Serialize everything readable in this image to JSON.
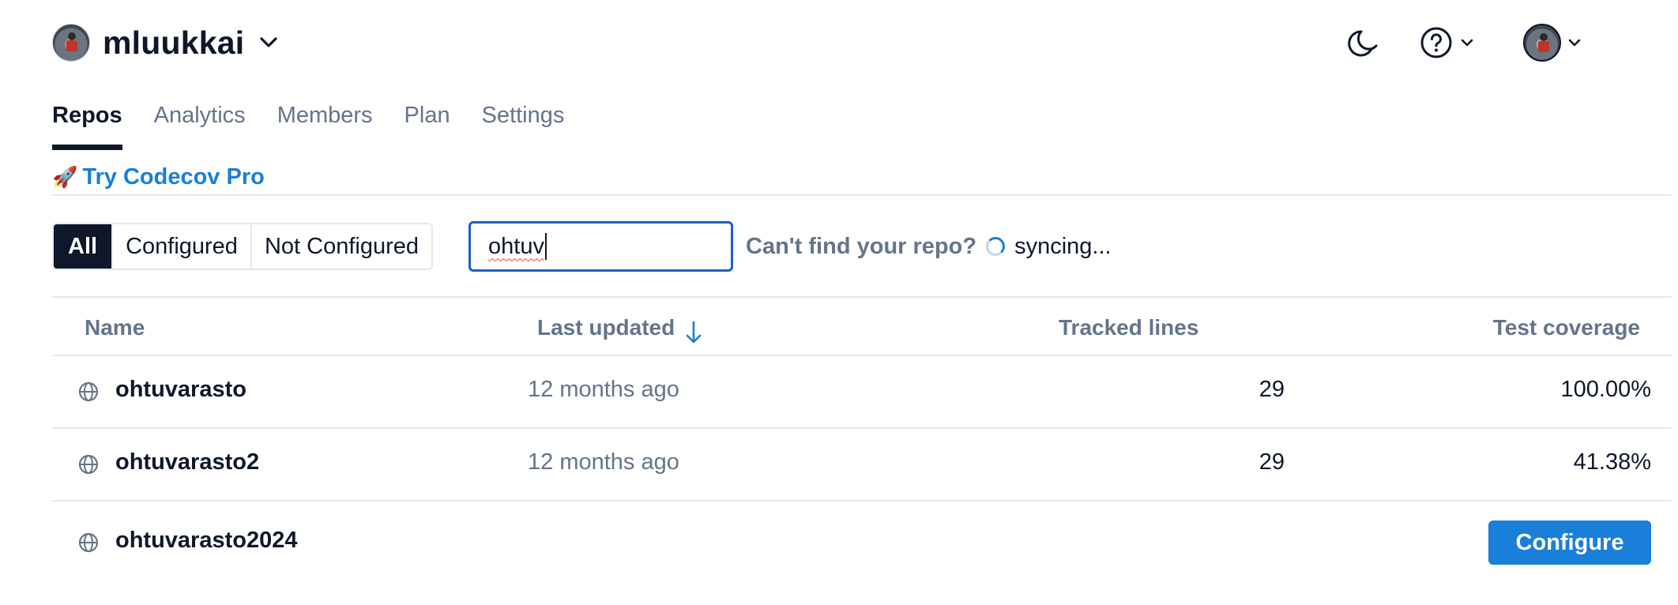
{
  "owner": {
    "name": "mluukkai"
  },
  "header": {
    "theme_icon": "moon-icon",
    "help_icon": "question-circle-icon"
  },
  "tabs": [
    {
      "label": "Repos",
      "active": true
    },
    {
      "label": "Analytics",
      "active": false
    },
    {
      "label": "Members",
      "active": false
    },
    {
      "label": "Plan",
      "active": false
    },
    {
      "label": "Settings",
      "active": false
    }
  ],
  "promo": {
    "icon": "🚀",
    "label": "Try Codecov Pro"
  },
  "filters": {
    "options": [
      {
        "label": "All",
        "active": true
      },
      {
        "label": "Configured",
        "active": false
      },
      {
        "label": "Not Configured",
        "active": false
      }
    ]
  },
  "search": {
    "value": "ohtuv"
  },
  "sync": {
    "question": "Can't find your repo?",
    "status": "syncing..."
  },
  "table": {
    "columns": {
      "name": "Name",
      "last_updated": "Last updated",
      "tracked_lines": "Tracked lines",
      "test_coverage": "Test coverage"
    },
    "rows": [
      {
        "name": "ohtuvarasto",
        "updated": "12 months ago",
        "lines": "29",
        "coverage": "100.00%"
      },
      {
        "name": "ohtuvarasto2",
        "updated": "12 months ago",
        "lines": "29",
        "coverage": "41.38%"
      },
      {
        "name": "ohtuvarasto2024",
        "updated": "",
        "lines": "",
        "coverage": "",
        "action": "Configure"
      }
    ]
  },
  "colors": {
    "accent": "#1a7fd8",
    "dark": "#0f172a",
    "muted": "#64748b",
    "border": "#e2e8f0"
  }
}
